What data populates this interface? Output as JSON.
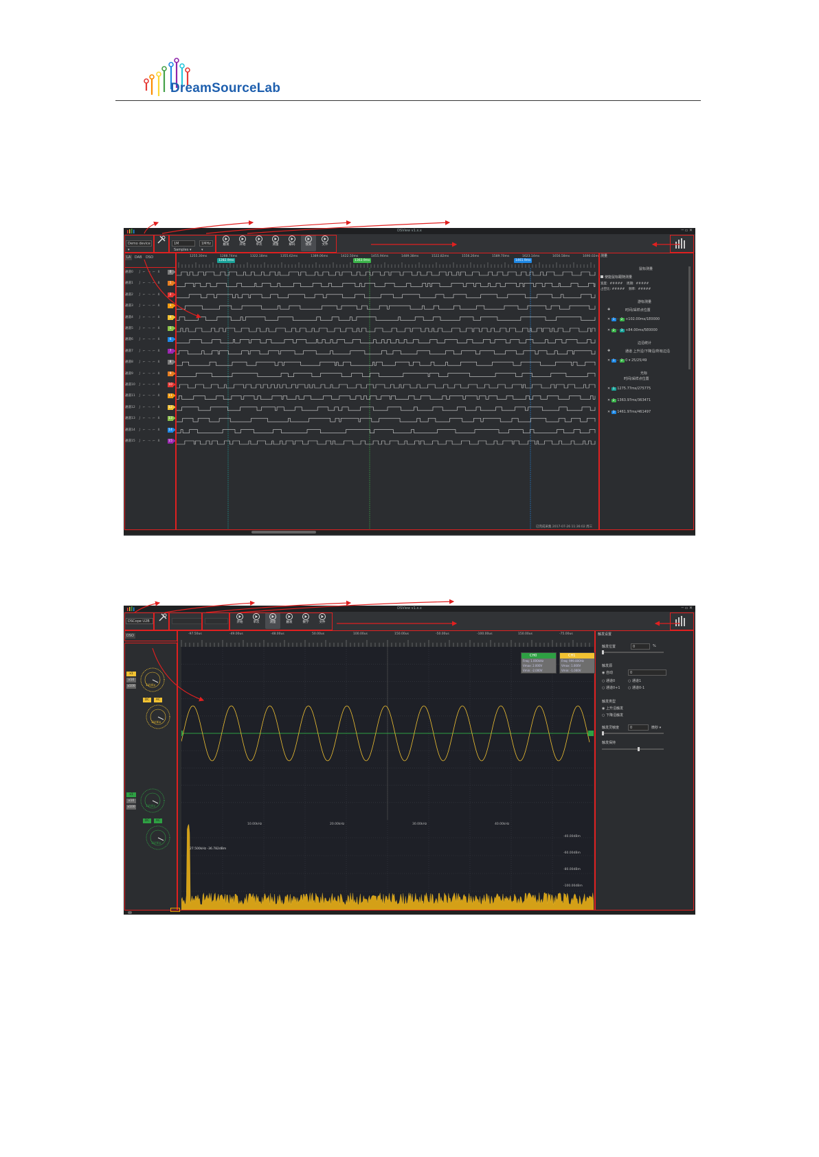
{
  "header": {
    "brand": "DreamSourceLab",
    "logo_colors": [
      "#e53935",
      "#fb8c00",
      "#fdd835",
      "#43a047",
      "#1e88e5",
      "#8e24aa",
      "#26c6da"
    ]
  },
  "screenshot1": {
    "title": "DSView v1.x.x",
    "device_combo": "Demo device ▾",
    "samples_combo": "1M Samples ▾",
    "freq_combo": "1MHz ▾",
    "toolbar_buttons": [
      "触发",
      "开始",
      "单次",
      "测量",
      "解码",
      "搜索",
      "文件"
    ],
    "ruler_labels": [
      "1255.30ms",
      "1288.74ms",
      "1322.18ms",
      "1355.62ms",
      "1389.06ms",
      "1422.50ms",
      "1455.94ms",
      "1489.38ms",
      "1522.82ms",
      "1556.26ms",
      "1589.70ms",
      "1623.14ms",
      "1656.58ms",
      "1690.02ms"
    ],
    "cursors": [
      {
        "label": "1282.9ms",
        "color": "#1aa39a"
      },
      {
        "label": "1363.9ms",
        "color": "#3bb44a"
      },
      {
        "label": "1461.9ms",
        "color": "#1e88e5"
      }
    ],
    "left_tabs": [
      "LA",
      "DAB",
      "DSO"
    ],
    "channel_colors": [
      "#7d7d7d",
      "#e67e22",
      "#e53935",
      "#f39c12",
      "#f1c232",
      "#8bc34a",
      "#1e88e5",
      "#9c27b0",
      "#7d7d7d",
      "#e67e22",
      "#e53935",
      "#f39c12",
      "#f1c232",
      "#8bc34a",
      "#1e88e5",
      "#9c27b0"
    ],
    "channel_prefix": "通道",
    "trigger_glyphs": "∫ ⌐ ¬ ⌐ ⊻",
    "side": {
      "header": "测量",
      "sec1_title": "鼠标测量",
      "sec1_check": "使能鼠标跟随测量",
      "sec1_rows": [
        [
          "宽度:",
          "#####",
          "周期:",
          "#####"
        ],
        [
          "占空比:",
          "#####",
          "频率:",
          "#####"
        ]
      ],
      "sec2_title": "游标测量",
      "sec2_sub": "时间/采样点位置",
      "sec2_rows": [
        "+102.00ms/1E0000",
        "+84.00ms/5E0000"
      ],
      "sec3_title": "边沿统计",
      "sec3_sub": "通道   上升沿/下降沿/所有边沿",
      "sec3_rows": [
        "0 ▾   25/25/49"
      ],
      "sec4_title": "光标",
      "sec4_sub": "时间/采样点位置",
      "sec4_rows": [
        "1275.77ms/275775",
        "1363.97ms/363471",
        "1461.97ms/461497"
      ]
    },
    "status": "已完成采集 2017-07-26 11:36:02 周三"
  },
  "screenshot2": {
    "title": "DSView v1.x.x",
    "device_combo": "DSCope U2B",
    "toolbar_buttons": [
      "开始",
      "单次",
      "测量",
      "触发",
      "数学",
      "文件"
    ],
    "ruler_labels": [
      "-97.50us",
      "-49.00us",
      "-48.00us",
      "50.00us",
      "100.00us",
      "150.00us",
      "-50.00us",
      "-100.00us",
      "150.00us",
      "-75.00us"
    ],
    "left_tab": "DSO",
    "ch0": {
      "btns": [
        "x1",
        "x10",
        "x100"
      ],
      "vdiv": "1V/div",
      "coupling": [
        "DC",
        "AC"
      ],
      "color": "#f1c232"
    },
    "ch1": {
      "btns": [
        "x1",
        "x10",
        "x100"
      ],
      "vdiv": "1V/div",
      "coupling": [
        "DC",
        "AC"
      ],
      "color": "#2ea043"
    },
    "info_boxes": [
      {
        "title": "CH0",
        "color": "#2ea043",
        "lines": [
          "Freq: 1.000kHz",
          "Vmax: 2.000V",
          "Vmin: -2.000V"
        ]
      },
      {
        "title": "CH1",
        "color": "#f1c232",
        "lines": [
          "Freq: 999.800Hz",
          "Vmax: 1.000V",
          "Vmin: -1.000V"
        ]
      }
    ],
    "fft_labels": [
      "10.00kHz",
      "20.00kHz",
      "30.00kHz",
      "40.00kHz"
    ],
    "fft_db": [
      "-40.00dBm",
      "-60.00dBm",
      "-80.00dBm",
      "-100.00dBm"
    ],
    "fft_peak": "27.500kHz  -36.782dBm",
    "side": {
      "header": "触发设置",
      "pos_label": "触发位置",
      "pos_value": "0",
      "pos_unit": "%",
      "source_label": "触发源",
      "source_opts": [
        "自动",
        "通道0",
        "通道1",
        "通道0+1",
        "通道0-1"
      ],
      "source_value": "0",
      "type_label": "触发类型",
      "type_opts": [
        "上升沿触发",
        "下降沿触发"
      ],
      "sens_label": "触发灵敏度",
      "sens_value": "0",
      "sens_unit": "微秒 ▾",
      "hold_label": "触发保持"
    }
  }
}
